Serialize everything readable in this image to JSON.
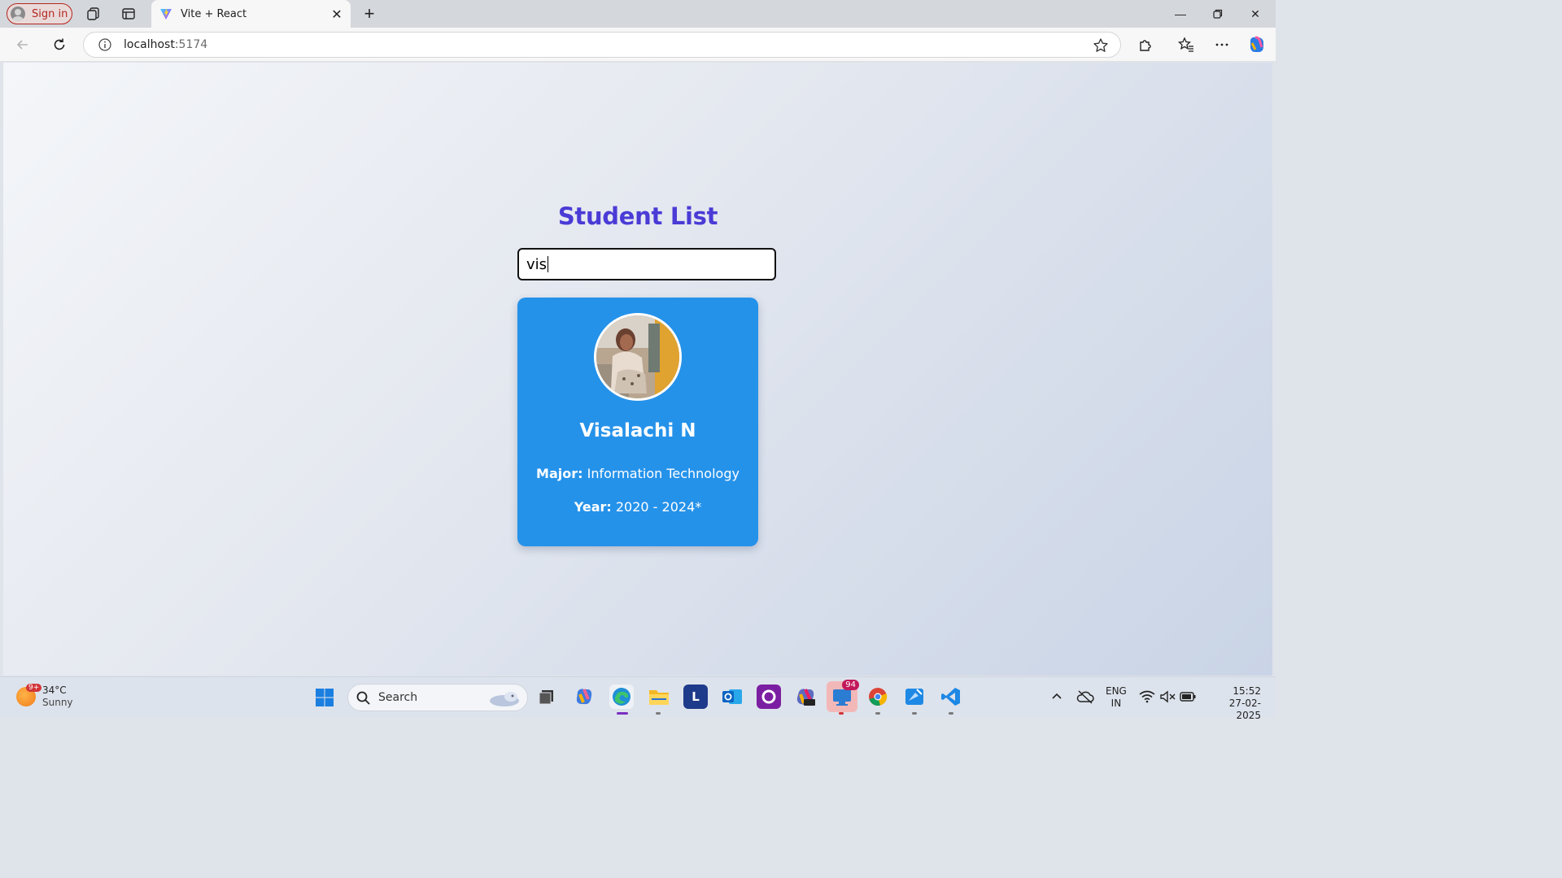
{
  "browser": {
    "signin_label": "Sign in",
    "tab_title": "Vite + React",
    "url_host": "localhost",
    "url_port": ":5174"
  },
  "page": {
    "title": "Student List",
    "search_value": "vis"
  },
  "student": {
    "name": "Visalachi N",
    "major_label": "Major:",
    "major_value": "Information Technology",
    "year_label": "Year:",
    "year_value": "2020 - 2024*"
  },
  "taskbar": {
    "weather_badge": "9+",
    "temperature": "34°C",
    "condition": "Sunny",
    "search_placeholder": "Search",
    "teams_badge": "94",
    "language": "ENG",
    "region": "IN",
    "time": "15:52",
    "date": "27-02-2025"
  },
  "colors": {
    "title": "#4a3bd6",
    "card": "#2592ea",
    "signin": "#b3261e"
  }
}
